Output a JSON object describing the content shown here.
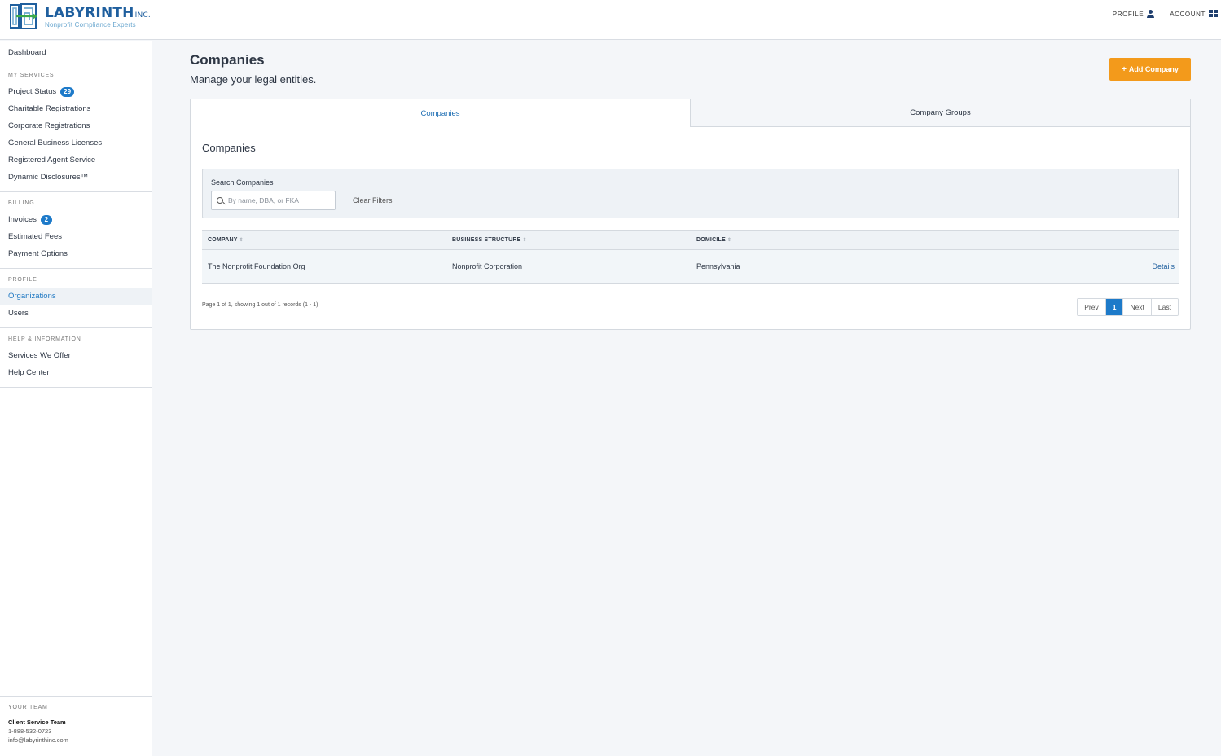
{
  "brand": {
    "name": "LABYRINTH",
    "suffix": "INC.",
    "tagline": "Nonprofit Compliance Experts",
    "colors": {
      "primary": "#1f5f9e",
      "accent": "#f39a1b",
      "badge": "#1d7ac9"
    }
  },
  "topnav": {
    "profile_label": "PROFILE",
    "account_label": "ACCOUNT"
  },
  "sidebar": {
    "dashboard": "Dashboard",
    "my_services": {
      "heading": "MY SERVICES",
      "items": [
        {
          "label": "Project Status",
          "badge": "29"
        },
        {
          "label": "Charitable Registrations"
        },
        {
          "label": "Corporate Registrations"
        },
        {
          "label": "General Business Licenses"
        },
        {
          "label": "Registered Agent Service"
        },
        {
          "label": "Dynamic Disclosures™"
        }
      ]
    },
    "billing": {
      "heading": "BILLING",
      "items": [
        {
          "label": "Invoices",
          "badge": "2"
        },
        {
          "label": "Estimated Fees"
        },
        {
          "label": "Payment Options"
        }
      ]
    },
    "profile": {
      "heading": "PROFILE",
      "items": [
        {
          "label": "Organizations",
          "active": true
        },
        {
          "label": "Users"
        }
      ]
    },
    "help": {
      "heading": "HELP & INFORMATION",
      "items": [
        {
          "label": "Services We Offer"
        },
        {
          "label": "Help Center"
        }
      ]
    },
    "team": {
      "heading": "YOUR TEAM",
      "name": "Client Service Team",
      "phone": "1-888-532-0723",
      "email": "info@labyrinthinc.com"
    }
  },
  "main": {
    "title": "Companies",
    "subtitle": "Manage your legal entities.",
    "add_button": "Add Company",
    "tabs": [
      {
        "label": "Companies",
        "active": true
      },
      {
        "label": "Company Groups",
        "active": false
      }
    ],
    "section_title": "Companies",
    "search": {
      "label": "Search Companies",
      "placeholder": "By name, DBA, or FKA",
      "value": "",
      "clear_label": "Clear Filters"
    },
    "table": {
      "columns": [
        "COMPANY",
        "BUSINESS STRUCTURE",
        "DOMICILE"
      ],
      "rows": [
        {
          "company": "The Nonprofit Foundation Org",
          "structure": "Nonprofit Corporation",
          "domicile": "Pennsylvania",
          "action": "Details"
        }
      ]
    },
    "pagination": {
      "info": "Page 1 of 1, showing 1 out of 1 records (1 - 1)",
      "prev": "Prev",
      "current": "1",
      "next": "Next",
      "last": "Last"
    }
  }
}
